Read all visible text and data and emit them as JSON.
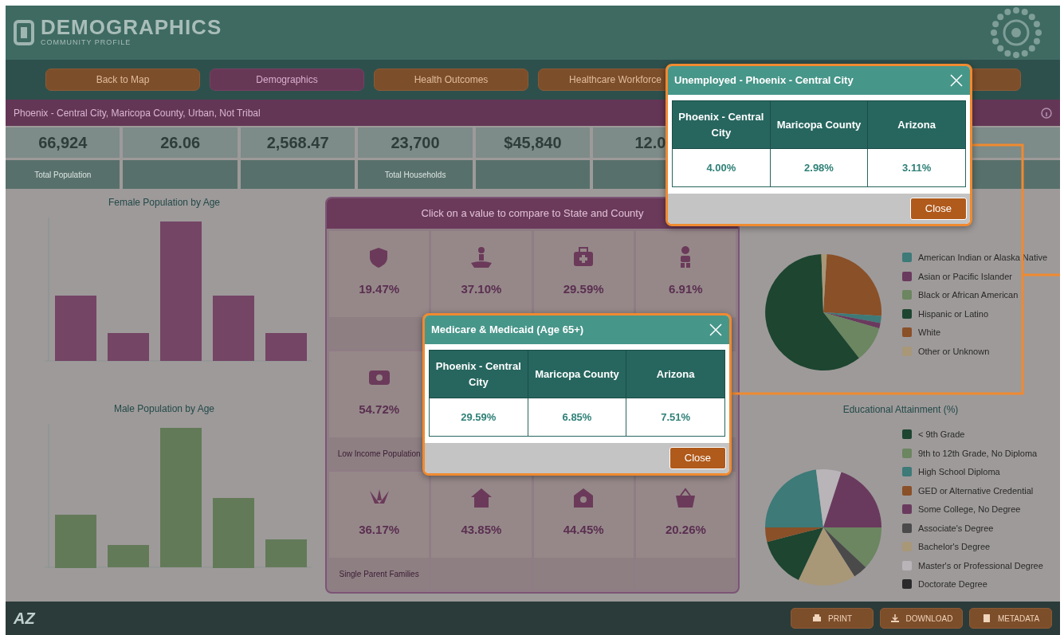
{
  "header": {
    "title": "DEMOGRAPHICS",
    "subtitle": "COMMUNITY PROFILE"
  },
  "nav_buttons": [
    {
      "label": "Back to Map",
      "selected": false
    },
    {
      "label": "Demographics",
      "selected": true
    },
    {
      "label": "Health Outcomes",
      "selected": false
    },
    {
      "label": "Healthcare Workforce",
      "selected": false
    },
    {
      "selected": false
    }
  ],
  "breadcrumb": "Phoenix - Central City, Maricopa County, Urban, Not Tribal",
  "stats": [
    {
      "value": "66,924",
      "label": "Total Population"
    },
    {
      "value": "26.06"
    },
    {
      "value": "2,568.47"
    },
    {
      "value": "23,700",
      "label": "Total Households"
    },
    {
      "value": "$45,840"
    },
    {
      "value": "12.0"
    }
  ],
  "female_chart": {
    "title": "Female Population by Age"
  },
  "male_chart": {
    "title": "Male Population by Age"
  },
  "compare_panel": {
    "title": "Click on a value to compare to State and County",
    "rows": [
      [
        {
          "value": "19.47%"
        },
        {
          "value": "37.10%"
        },
        {
          "value": "29.59%"
        },
        {
          "value": "6.91%"
        }
      ],
      [
        {
          "value": "54.72%",
          "label": "Low Income Population"
        }
      ],
      [
        {
          "value": "36.17%",
          "label": "Single Parent Families"
        },
        {
          "value": "43.85%"
        },
        {
          "value": "44.45%"
        },
        {
          "value": "20.26%"
        }
      ]
    ]
  },
  "race_chart": {
    "legend": [
      {
        "label": "American Indian or Alaska Native",
        "color": "#3d7a78"
      },
      {
        "label": "Asian or Pacific Islander",
        "color": "#6a3a5e"
      },
      {
        "label": "Black or African American",
        "color": "#6b8660"
      },
      {
        "label": "Hispanic or Latino",
        "color": "#1d4530"
      },
      {
        "label": "White",
        "color": "#8a5028"
      },
      {
        "label": "Other or Unknown",
        "color": "#a89878"
      }
    ]
  },
  "education_chart": {
    "title": "Educational Attainment (%)",
    "legend": [
      {
        "label": "< 9th Grade",
        "color": "#1d4530"
      },
      {
        "label": "9th to 12th Grade, No Diploma",
        "color": "#6b8660"
      },
      {
        "label": "High School Diploma",
        "color": "#3d7a78"
      },
      {
        "label": "GED or Alternative Credential",
        "color": "#8a5028"
      },
      {
        "label": "Some College, No Degree",
        "color": "#6a3a5e"
      },
      {
        "label": "Associate's Degree",
        "color": "#4a4a4a"
      },
      {
        "label": "Bachelor's Degree",
        "color": "#a89878"
      },
      {
        "label": "Master's or Professional Degree",
        "color": "#b8b4b8"
      },
      {
        "label": "Doctorate Degree",
        "color": "#2a2a2a"
      }
    ]
  },
  "footer": {
    "logo": "AZ",
    "buttons": [
      "PRINT",
      "DOWNLOAD",
      "METADATA"
    ]
  },
  "popups": [
    {
      "title": "Unemployed - Phoenix - Central City",
      "columns": [
        "Phoenix - Central City",
        "Maricopa County",
        "Arizona"
      ],
      "values": [
        "4.00%",
        "2.98%",
        "3.11%"
      ],
      "close_label": "Close"
    },
    {
      "title": "Medicare & Medicaid (Age 65+)",
      "columns": [
        "Phoenix - Central City",
        "Maricopa County",
        "Arizona"
      ],
      "values": [
        "29.59%",
        "6.85%",
        "7.51%"
      ],
      "close_label": "Close"
    }
  ]
}
